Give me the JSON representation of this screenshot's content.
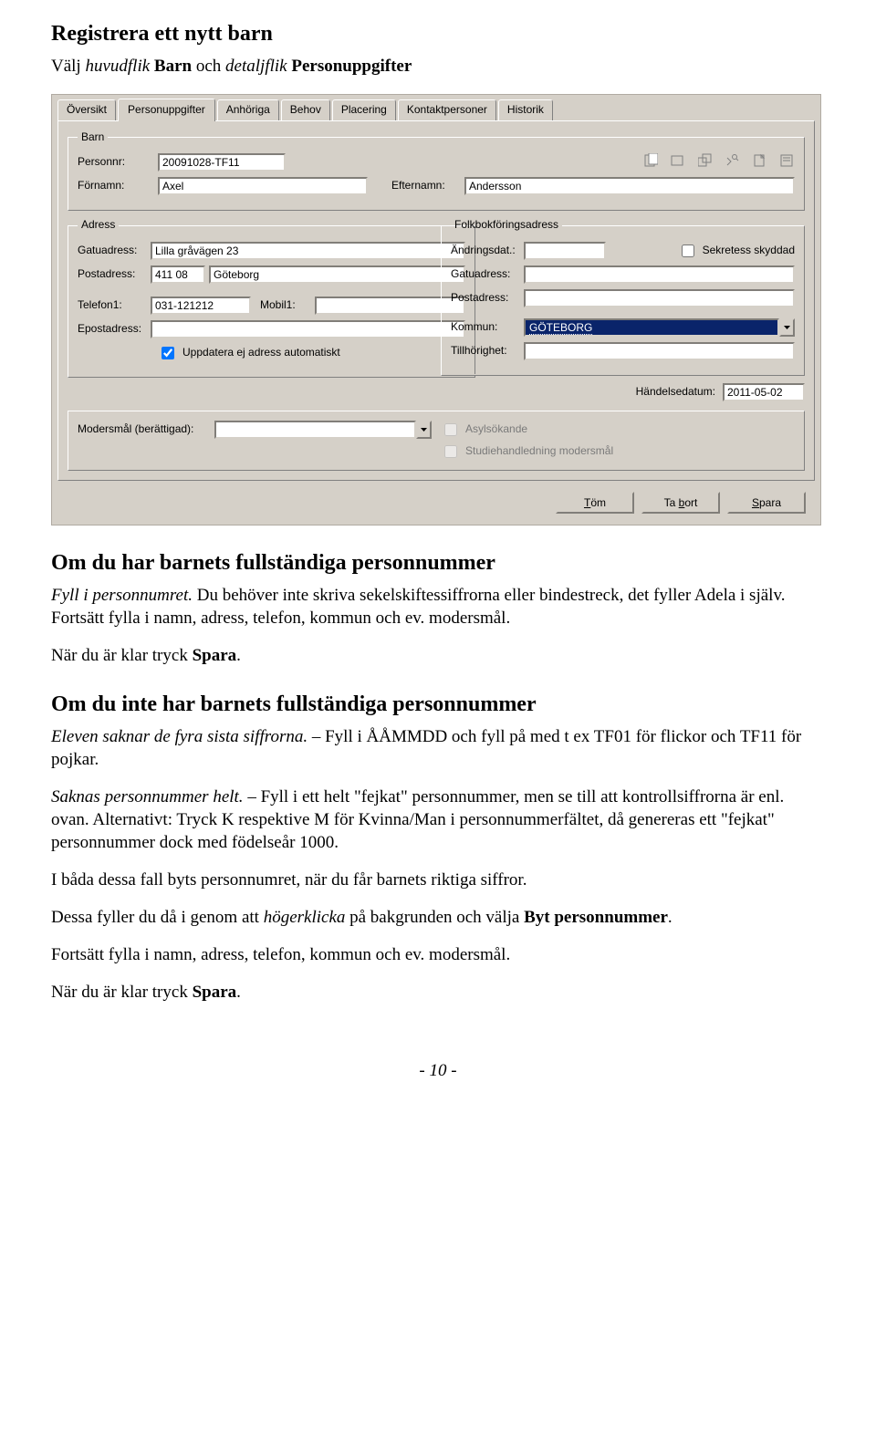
{
  "doc": {
    "title": "Registrera ett nytt barn",
    "intro_pre": "Välj ",
    "intro_italic1": "huvudflik",
    "intro_mid1": " ",
    "intro_bold1": "Barn",
    "intro_mid2": " och ",
    "intro_italic2": "detaljflik",
    "intro_mid3": " ",
    "intro_bold2": "Personuppgifter",
    "sec1_title": "Om du har barnets fullständiga personnummer",
    "sec1_p1a": "Fyll i personnumret.",
    "sec1_p1b": " Du behöver inte skriva sekelskiftessiffrorna eller bindestreck, det fyller Adela i själv. Fortsätt fylla i namn, adress, telefon, kommun och ev. modersmål.",
    "sec1_p2a": "När du är klar tryck ",
    "sec1_p2b": "Spara",
    "sec1_p2c": ".",
    "sec2_title": "Om du inte har barnets fullständiga personnummer",
    "sec2_p1a": "Eleven saknar de fyra sista siffrorna.",
    "sec2_p1b": " – Fyll i ÅÅMMDD och fyll på med t ex TF01 för flickor och TF11 för pojkar.",
    "sec2_p2a": "Saknas personnummer helt.",
    "sec2_p2b": " – Fyll i ett helt \"fejkat\" personnummer, men se till att kontrollsiffrorna är enl. ovan. Alternativt: Tryck K respektive M för Kvinna/Man i personnummerfältet, då genereras ett \"fejkat\" personnummer dock med födelseår 1000.",
    "sec2_p3": "I båda dessa fall byts personnumret, när du får barnets riktiga siffror.",
    "sec2_p4a": "Dessa fyller du då i genom att ",
    "sec2_p4_it": "högerklicka",
    "sec2_p4b": " på bakgrunden och välja ",
    "sec2_p4_bd": "Byt personnummer",
    "sec2_p4c": ".",
    "sec2_p5": "Fortsätt fylla i namn, adress, telefon, kommun och ev. modersmål.",
    "sec2_p6a": "När du är klar tryck ",
    "sec2_p6b": "Spara",
    "sec2_p6c": ".",
    "page_number": "- 10 -"
  },
  "form": {
    "tabs": [
      "Översikt",
      "Personuppgifter",
      "Anhöriga",
      "Behov",
      "Placering",
      "Kontaktpersoner",
      "Historik"
    ],
    "active_tab": 1,
    "fs_barn": {
      "legend": "Barn",
      "labels": {
        "personnr": "Personnr:",
        "fornamn": "Förnamn:",
        "efternamn": "Efternamn:"
      },
      "values": {
        "personnr": "20091028-TF11",
        "fornamn": "Axel",
        "efternamn": "Andersson"
      }
    },
    "fs_adress": {
      "legend": "Adress",
      "labels": {
        "gatuadress": "Gatuadress:",
        "postadress": "Postadress:",
        "telefon1": "Telefon1:",
        "mobil1": "Mobil1:",
        "epost": "Epostadress:"
      },
      "values": {
        "gatuadress": "Lilla gråvägen 23",
        "postnr": "411 08",
        "postort": "Göteborg",
        "telefon1": "031-121212",
        "mobil1": "",
        "epost": ""
      },
      "cb_updatera": {
        "checked": true,
        "label": "Uppdatera ej adress automatiskt"
      }
    },
    "fs_folk": {
      "legend": "Folkbokföringsadress",
      "labels": {
        "andringsdat": "Ändringsdat.:",
        "sekretess": "Sekretess skyddad",
        "gatuadress": "Gatuadress:",
        "postadress": "Postadress:",
        "kommun": "Kommun:",
        "tillhorighet": "Tillhörighet:"
      },
      "values": {
        "andringsdat": "",
        "gatuadress": "",
        "postadress": "",
        "kommun": "GÖTEBORG",
        "tillhorighet": ""
      },
      "sekretess_checked": false
    },
    "handelse": {
      "label": "Händelsedatum:",
      "value": "2011-05-02"
    },
    "modersmal": {
      "label": "Modersmål (berättigad):",
      "value": ""
    },
    "extra_checks": {
      "asyl": "Asylsökande",
      "studie": "Studiehandledning modersmål"
    },
    "buttons": {
      "tom": "Töm",
      "ta_bort": "Ta bort",
      "spara": "Spara"
    }
  }
}
